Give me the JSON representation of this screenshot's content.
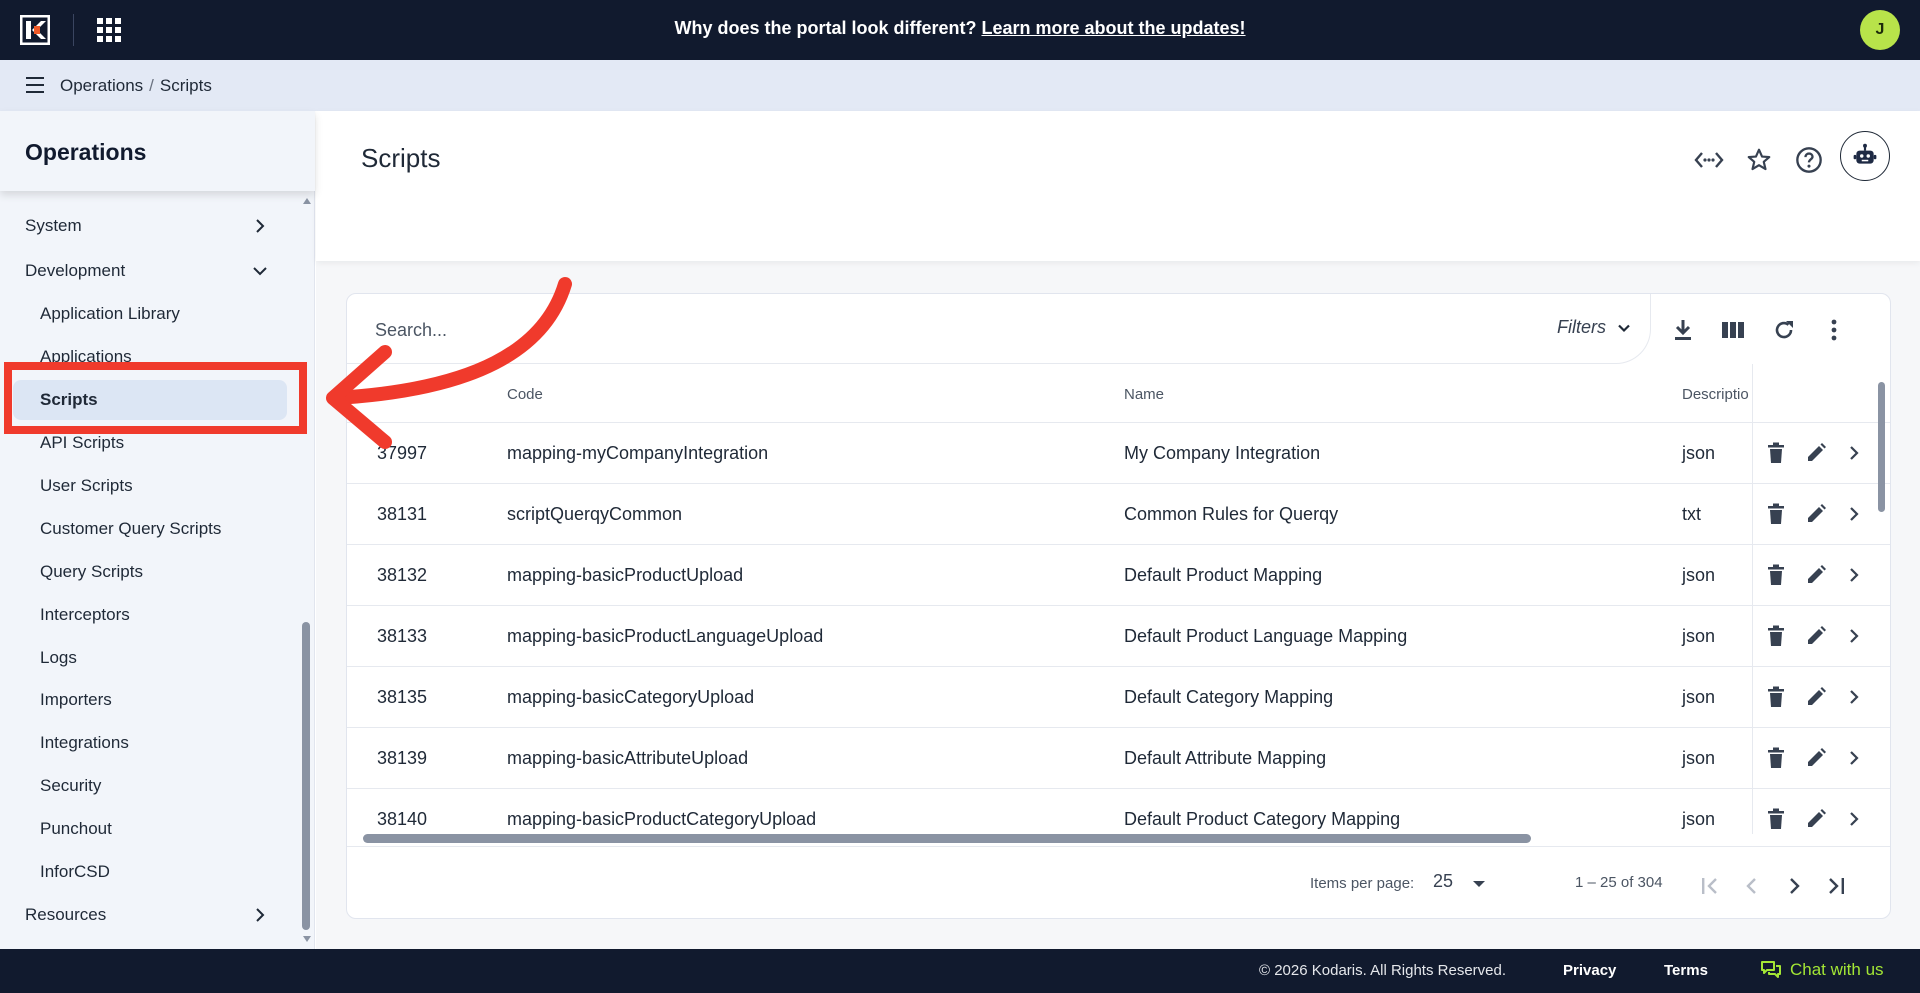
{
  "topbar": {
    "announcement": "Why does the portal look different?",
    "announcement_link": "Learn more about the updates!",
    "avatar_initial": "J"
  },
  "breadcrumb": {
    "items": [
      "Operations",
      "Scripts"
    ],
    "separator": "/"
  },
  "sidebar": {
    "title": "Operations",
    "items": [
      {
        "label": "System",
        "type": "group",
        "chevron": "right"
      },
      {
        "label": "Development",
        "type": "group",
        "chevron": "down"
      },
      {
        "label": "Application Library",
        "type": "child"
      },
      {
        "label": "Applications",
        "type": "child"
      },
      {
        "label": "Scripts",
        "type": "child",
        "active": true
      },
      {
        "label": "API Scripts",
        "type": "child"
      },
      {
        "label": "User Scripts",
        "type": "child"
      },
      {
        "label": "Customer Query Scripts",
        "type": "child"
      },
      {
        "label": "Query Scripts",
        "type": "child"
      },
      {
        "label": "Interceptors",
        "type": "child"
      },
      {
        "label": "Logs",
        "type": "child"
      },
      {
        "label": "Importers",
        "type": "child"
      },
      {
        "label": "Integrations",
        "type": "child"
      },
      {
        "label": "Security",
        "type": "child"
      },
      {
        "label": "Punchout",
        "type": "child"
      },
      {
        "label": "InforCSD",
        "type": "child"
      },
      {
        "label": "Resources",
        "type": "group",
        "chevron": "right"
      }
    ]
  },
  "main": {
    "title": "Scripts",
    "header_icons": [
      "code-icon",
      "star-icon",
      "help-icon",
      "robot-icon"
    ]
  },
  "table": {
    "search_placeholder": "Search...",
    "filters_label": "Filters",
    "toolbar_icons": [
      "download-icon",
      "columns-icon",
      "refresh-icon",
      "more-vert-icon"
    ],
    "columns": [
      "",
      "Code",
      "Name",
      "Descriptio"
    ],
    "rows": [
      {
        "id": "37997",
        "code": "mapping-myCompanyIntegration",
        "name": "My Company Integration",
        "desc": "json"
      },
      {
        "id": "38131",
        "code": "scriptQuerqyCommon",
        "name": "Common Rules for Querqy",
        "desc": "txt"
      },
      {
        "id": "38132",
        "code": "mapping-basicProductUpload",
        "name": "Default Product Mapping",
        "desc": "json"
      },
      {
        "id": "38133",
        "code": "mapping-basicProductLanguageUpload",
        "name": "Default Product Language Mapping",
        "desc": "json"
      },
      {
        "id": "38135",
        "code": "mapping-basicCategoryUpload",
        "name": "Default Category Mapping",
        "desc": "json"
      },
      {
        "id": "38139",
        "code": "mapping-basicAttributeUpload",
        "name": "Default Attribute Mapping",
        "desc": "json"
      },
      {
        "id": "38140",
        "code": "mapping-basicProductCategoryUpload",
        "name": "Default Product Category Mapping",
        "desc": "json"
      }
    ]
  },
  "paginator": {
    "items_per_page_label": "Items per page:",
    "items_per_page": "25",
    "range": "1 – 25 of 304"
  },
  "footer": {
    "copyright": "© 2026 Kodaris. All Rights Reserved.",
    "privacy": "Privacy",
    "terms": "Terms",
    "chat": "Chat with us"
  },
  "colors": {
    "topbar_bg": "#111a2e",
    "breadcrumb_bg": "#e3e9f5",
    "sidebar_bg": "#f2f5fa",
    "active_item_bg": "#dce6f4",
    "annotation_red": "#f03a2c",
    "avatar_bg": "#b8e34a",
    "chat_green": "#a3e635"
  }
}
